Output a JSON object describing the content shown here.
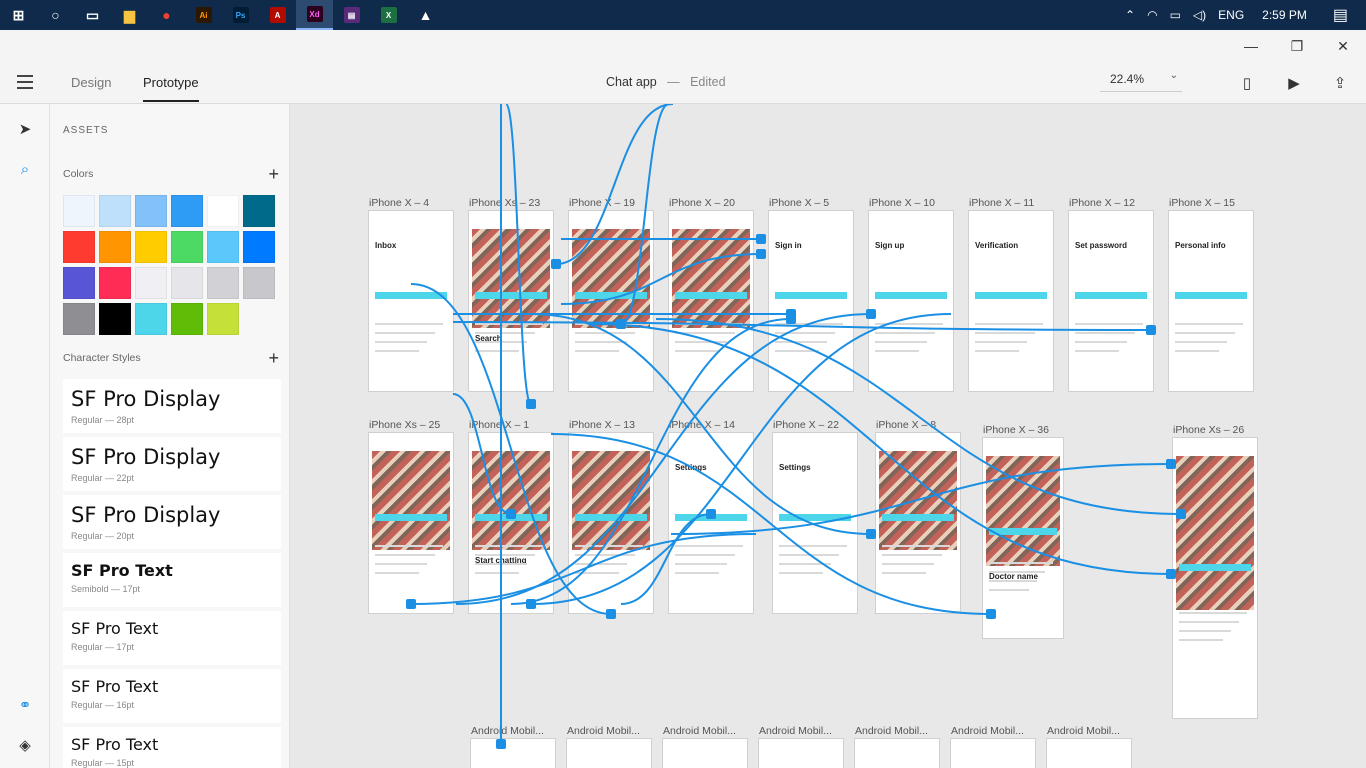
{
  "taskbar": {
    "apps": [
      {
        "name": "windows-start-icon",
        "glyph": "⊞",
        "bg": "",
        "fg": "#ffffff"
      },
      {
        "name": "cortana-icon",
        "glyph": "○",
        "bg": "",
        "fg": "#ffffff"
      },
      {
        "name": "task-view-icon",
        "glyph": "▭",
        "bg": "",
        "fg": "#ffffff"
      },
      {
        "name": "file-explorer-icon",
        "glyph": "▆",
        "bg": "",
        "fg": "#f5c542"
      },
      {
        "name": "chrome-icon",
        "glyph": "●",
        "bg": "",
        "fg": "#e94235"
      },
      {
        "name": "illustrator-icon",
        "glyph": "Ai",
        "bg": "#2c1700",
        "fg": "#ff9a00"
      },
      {
        "name": "photoshop-icon",
        "glyph": "Ps",
        "bg": "#001d34",
        "fg": "#31a8ff"
      },
      {
        "name": "acrobat-icon",
        "glyph": "A",
        "bg": "#b30b00",
        "fg": "#ffffff"
      },
      {
        "name": "xd-icon",
        "glyph": "Xd",
        "bg": "#2e001f",
        "fg": "#ff61f6"
      },
      {
        "name": "winrar-icon",
        "glyph": "▤",
        "bg": "#5a2a7a",
        "fg": "#ffffff"
      },
      {
        "name": "excel-icon",
        "glyph": "X",
        "bg": "#1d6f42",
        "fg": "#ffffff"
      },
      {
        "name": "photos-icon",
        "glyph": "▲",
        "bg": "",
        "fg": "#ffffff"
      }
    ],
    "tray": {
      "language": "ENG",
      "time": "2:59 PM"
    }
  },
  "app": {
    "tabs": {
      "design": "Design",
      "prototype": "Prototype"
    },
    "document": {
      "title": "Chat app",
      "separator": "—",
      "status": "Edited"
    },
    "zoom": "22.4%"
  },
  "assets": {
    "title": "ASSETS",
    "colors_title": "Colors",
    "character_styles_title": "Character Styles",
    "colors": [
      "#eef5fd",
      "#bfe0fb",
      "#82c1f9",
      "#2e9bf5",
      "#ffffff",
      "#006a8a",
      "#ff3b30",
      "#ff9500",
      "#ffcc00",
      "#4cd964",
      "#5ac8fa",
      "#007aff",
      "#5856d6",
      "#ff2d55",
      "#efeff4",
      "#e5e5ea",
      "#d1d1d6",
      "#c7c7cc",
      "#8e8e93",
      "#000000",
      "#4dd5ea",
      "#5fbc07",
      "#c6e03a"
    ],
    "character_styles": [
      {
        "name": "SF Pro Display",
        "meta": "Regular — 28pt",
        "size": 21,
        "weight": "normal"
      },
      {
        "name": "SF Pro Display",
        "meta": "Regular — 22pt",
        "size": 21,
        "weight": "normal"
      },
      {
        "name": "SF Pro Display",
        "meta": "Regular — 20pt",
        "size": 21,
        "weight": "normal"
      },
      {
        "name": "SF Pro Text",
        "meta": "Semibold — 17pt",
        "size": 16,
        "weight": "bold"
      },
      {
        "name": "SF Pro Text",
        "meta": "Regular — 17pt",
        "size": 16,
        "weight": "normal"
      },
      {
        "name": "SF Pro Text",
        "meta": "Regular — 16pt",
        "size": 16,
        "weight": "normal"
      },
      {
        "name": "SF Pro Text",
        "meta": "Regular — 15pt",
        "size": 16,
        "weight": "normal"
      }
    ]
  },
  "artboards": [
    {
      "label": "iPhone X – 4",
      "title": "Inbox"
    },
    {
      "label": "iPhone Xs – 23",
      "title": "Search"
    },
    {
      "label": "iPhone X – 19",
      "title": ""
    },
    {
      "label": "iPhone X – 20",
      "title": ""
    },
    {
      "label": "iPhone X – 5",
      "title": "Sign in"
    },
    {
      "label": "iPhone X – 10",
      "title": "Sign up"
    },
    {
      "label": "iPhone X – 11",
      "title": "Verification"
    },
    {
      "label": "iPhone X – 12",
      "title": "Set password"
    },
    {
      "label": "iPhone X – 15",
      "title": "Personal info"
    },
    {
      "label": "iPhone Xs – 25",
      "title": ""
    },
    {
      "label": "iPhone X – 1",
      "title": "Start chatting"
    },
    {
      "label": "iPhone X – 13",
      "title": ""
    },
    {
      "label": "iPhone X – 14",
      "title": "Settings"
    },
    {
      "label": "iPhone X – 22",
      "title": "Settings"
    },
    {
      "label": "iPhone X – 8",
      "title": ""
    },
    {
      "label": "iPhone X – 36",
      "title": "Doctor name"
    },
    {
      "label": "iPhone Xs – 26",
      "title": ""
    },
    {
      "label": "Android Mobil...",
      "title": ""
    },
    {
      "label": "Android Mobil...",
      "title": ""
    },
    {
      "label": "Android Mobil...",
      "title": ""
    },
    {
      "label": "Android Mobil...",
      "title": ""
    },
    {
      "label": "Android Mobil...",
      "title": ""
    },
    {
      "label": "Android Mobil...",
      "title": ""
    },
    {
      "label": "Android Mobil...",
      "title": ""
    }
  ]
}
